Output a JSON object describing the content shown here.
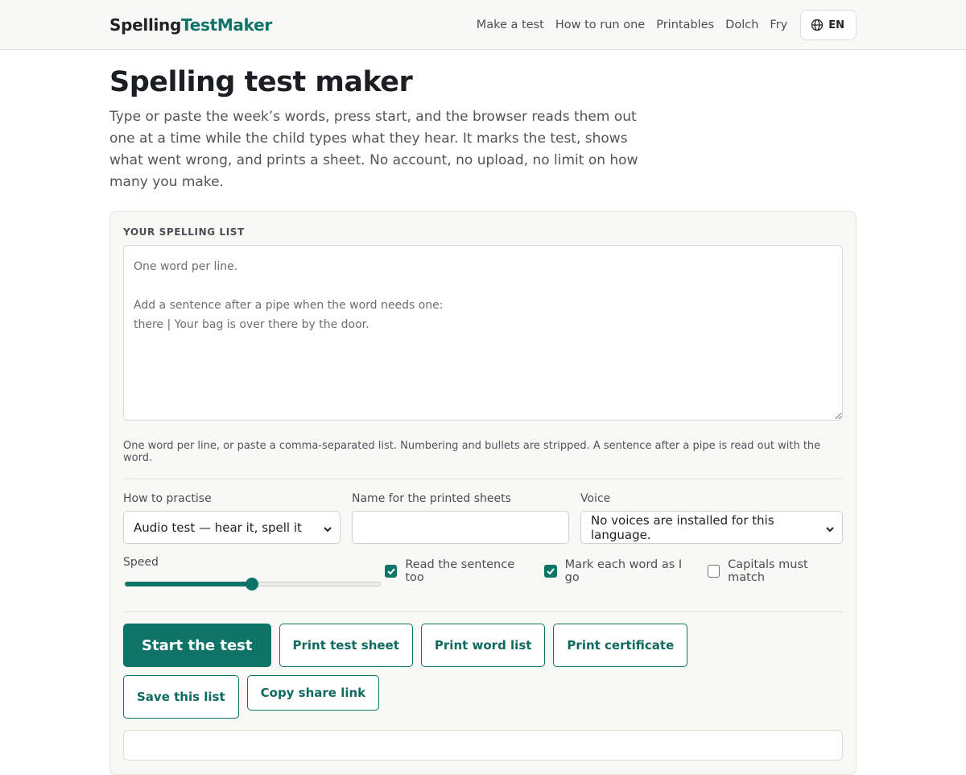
{
  "header": {
    "brand_part1": "Spelling",
    "brand_part2": "TestMaker",
    "nav": [
      "Make a test",
      "How to run one",
      "Printables",
      "Dolch",
      "Fry"
    ],
    "language": "EN"
  },
  "main": {
    "title": "Spelling test maker",
    "lead": "Type or paste the week’s words, press start, and the browser reads them out one at a time while the child types what they hear. It marks the test, shows what went wrong, and prints a sheet. No account, no upload, no limit on how many you make."
  },
  "form": {
    "list_label": "Your spelling list",
    "list_placeholder": "One word per line.\n\nAdd a sentence after a pipe when the word needs one:\nthere | Your bag is over there by the door.",
    "list_value": "",
    "hint": "One word per line, or paste a comma-separated list. Numbering and bullets are stripped. A sentence after a pipe is read out with the word.",
    "practise_label": "How to practise",
    "practise_selected": "Audio test — hear it, spell it",
    "name_label": "Name for the printed sheets",
    "name_value": "",
    "voice_label": "Voice",
    "voice_selected": "No voices are installed for this language.",
    "speed_label": "Speed",
    "speed_value": 0.5,
    "checks": [
      {
        "label": "Read the sentence too",
        "checked": true
      },
      {
        "label": "Mark each word as I go",
        "checked": true
      },
      {
        "label": "Capitals must match",
        "checked": false
      }
    ],
    "buttons": {
      "start": "Start the test",
      "print_sheet": "Print test sheet",
      "print_list": "Print word list",
      "print_cert": "Print certificate",
      "save": "Save this list",
      "share": "Copy share link"
    },
    "status": ""
  },
  "colors": {
    "accent": "#0f7468",
    "brand_accent": "#0f7468"
  }
}
